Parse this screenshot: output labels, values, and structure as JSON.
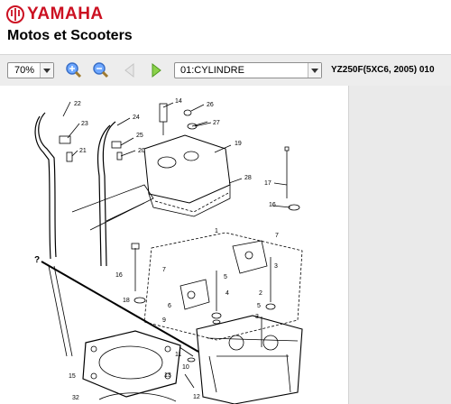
{
  "brand": {
    "name": "YAMAHA",
    "subtitle": "Motos et Scooters"
  },
  "toolbar": {
    "zoom": "70%",
    "chapter": "01:CYLINDRE",
    "model": "YZ250F(5XC6, 2005) 010"
  },
  "diagram": {
    "callouts": [
      "22",
      "23",
      "21",
      "24",
      "25",
      "20",
      "14",
      "26",
      "27",
      "19",
      "28",
      "17",
      "16",
      "7",
      "18",
      "5",
      "1",
      "3",
      "6",
      "9",
      "4",
      "2",
      "10",
      "11",
      "13",
      "12",
      "15",
      "32"
    ],
    "unknown_marker": "?"
  },
  "colors": {
    "brand_red": "#cc1122",
    "toolbar_bg": "#ededed",
    "panel_bg": "#eaeaea"
  }
}
